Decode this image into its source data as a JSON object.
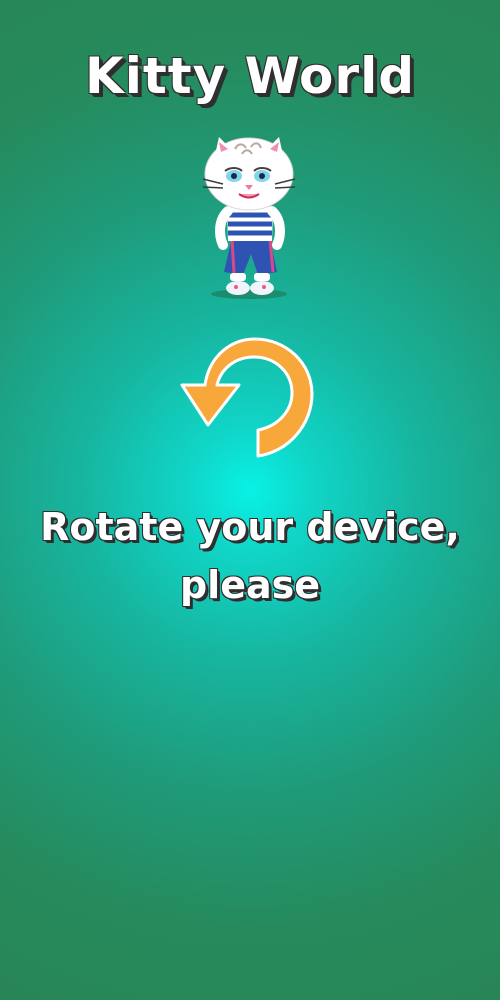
{
  "game": {
    "title": "Kitty World"
  },
  "rotate_prompt": {
    "line1": "Rotate your device,",
    "line2": "please"
  },
  "icons": {
    "character": "kitty-character-icon",
    "rotate": "rotate-arrow-icon"
  },
  "colors": {
    "background_center": "#08f2e6",
    "background_edge": "#288656",
    "arrow": "#f8a83a",
    "text": "#ffffff",
    "text_outline": "#2f2f2f"
  }
}
